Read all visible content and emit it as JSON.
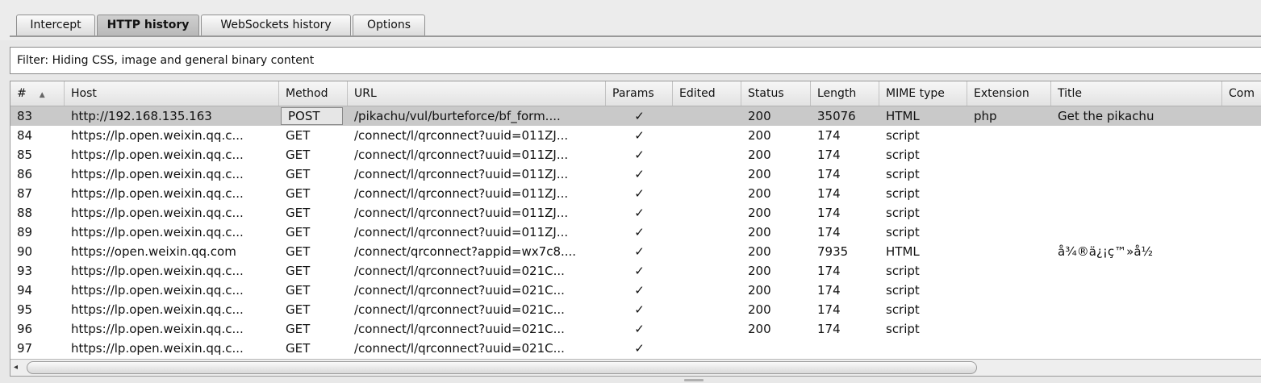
{
  "tabs": [
    {
      "label": "Intercept",
      "active": false
    },
    {
      "label": "HTTP history",
      "active": true
    },
    {
      "label": "WebSockets history",
      "active": false
    },
    {
      "label": "Options",
      "active": false
    }
  ],
  "filter": {
    "text": "Filter: Hiding CSS, image and general binary content"
  },
  "columns": {
    "num": "#",
    "host": "Host",
    "method": "Method",
    "url": "URL",
    "params": "Params",
    "edited": "Edited",
    "status": "Status",
    "length": "Length",
    "mime": "MIME type",
    "extension": "Extension",
    "title": "Title",
    "comment": "Com"
  },
  "sort": {
    "column": "#",
    "direction": "ascending",
    "icon": "sort-up-icon"
  },
  "rows": [
    {
      "num": "83",
      "host": "http://192.168.135.163",
      "method": "POST",
      "url": "/pikachu/vul/burteforce/bf_form....",
      "params": "✓",
      "edited": "",
      "status": "200",
      "length": "35076",
      "mime": "HTML",
      "ext": "php",
      "title": "Get the pikachu",
      "selected": true
    },
    {
      "num": "84",
      "host": "https://lp.open.weixin.qq.c...",
      "method": "GET",
      "url": "/connect/l/qrconnect?uuid=011ZJ...",
      "params": "✓",
      "edited": "",
      "status": "200",
      "length": "174",
      "mime": "script",
      "ext": "",
      "title": ""
    },
    {
      "num": "85",
      "host": "https://lp.open.weixin.qq.c...",
      "method": "GET",
      "url": "/connect/l/qrconnect?uuid=011ZJ...",
      "params": "✓",
      "edited": "",
      "status": "200",
      "length": "174",
      "mime": "script",
      "ext": "",
      "title": ""
    },
    {
      "num": "86",
      "host": "https://lp.open.weixin.qq.c...",
      "method": "GET",
      "url": "/connect/l/qrconnect?uuid=011ZJ...",
      "params": "✓",
      "edited": "",
      "status": "200",
      "length": "174",
      "mime": "script",
      "ext": "",
      "title": ""
    },
    {
      "num": "87",
      "host": "https://lp.open.weixin.qq.c...",
      "method": "GET",
      "url": "/connect/l/qrconnect?uuid=011ZJ...",
      "params": "✓",
      "edited": "",
      "status": "200",
      "length": "174",
      "mime": "script",
      "ext": "",
      "title": ""
    },
    {
      "num": "88",
      "host": "https://lp.open.weixin.qq.c...",
      "method": "GET",
      "url": "/connect/l/qrconnect?uuid=011ZJ...",
      "params": "✓",
      "edited": "",
      "status": "200",
      "length": "174",
      "mime": "script",
      "ext": "",
      "title": ""
    },
    {
      "num": "89",
      "host": "https://lp.open.weixin.qq.c...",
      "method": "GET",
      "url": "/connect/l/qrconnect?uuid=011ZJ...",
      "params": "✓",
      "edited": "",
      "status": "200",
      "length": "174",
      "mime": "script",
      "ext": "",
      "title": ""
    },
    {
      "num": "90",
      "host": "https://open.weixin.qq.com",
      "method": "GET",
      "url": "/connect/qrconnect?appid=wx7c8....",
      "params": "✓",
      "edited": "",
      "status": "200",
      "length": "7935",
      "mime": "HTML",
      "ext": "",
      "title": "å¾®ä¿¡ç™»å½"
    },
    {
      "num": "93",
      "host": "https://lp.open.weixin.qq.c...",
      "method": "GET",
      "url": "/connect/l/qrconnect?uuid=021C...",
      "params": "✓",
      "edited": "",
      "status": "200",
      "length": "174",
      "mime": "script",
      "ext": "",
      "title": ""
    },
    {
      "num": "94",
      "host": "https://lp.open.weixin.qq.c...",
      "method": "GET",
      "url": "/connect/l/qrconnect?uuid=021C...",
      "params": "✓",
      "edited": "",
      "status": "200",
      "length": "174",
      "mime": "script",
      "ext": "",
      "title": ""
    },
    {
      "num": "95",
      "host": "https://lp.open.weixin.qq.c...",
      "method": "GET",
      "url": "/connect/l/qrconnect?uuid=021C...",
      "params": "✓",
      "edited": "",
      "status": "200",
      "length": "174",
      "mime": "script",
      "ext": "",
      "title": ""
    },
    {
      "num": "96",
      "host": "https://lp.open.weixin.qq.c...",
      "method": "GET",
      "url": "/connect/l/qrconnect?uuid=021C...",
      "params": "✓",
      "edited": "",
      "status": "200",
      "length": "174",
      "mime": "script",
      "ext": "",
      "title": ""
    },
    {
      "num": "97",
      "host": "https://lp.open.weixin.qq.c...",
      "method": "GET",
      "url": "/connect/l/qrconnect?uuid=021C...",
      "params": "✓",
      "edited": "",
      "status": "",
      "length": "",
      "mime": "",
      "ext": "",
      "title": ""
    }
  ],
  "scrollbar": {
    "left_arrow": "◂"
  }
}
